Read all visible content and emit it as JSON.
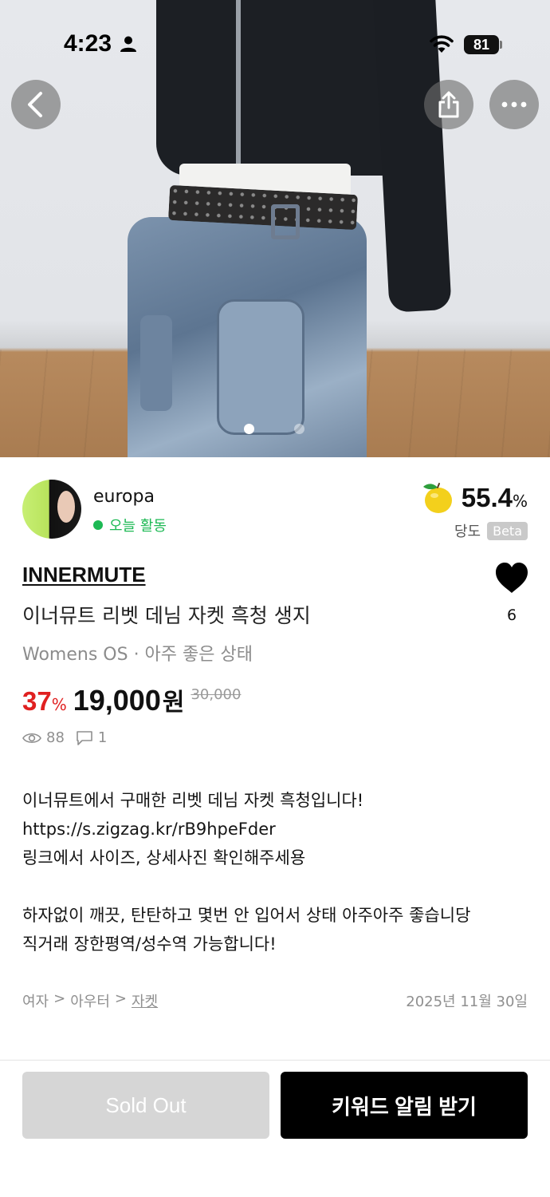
{
  "status_bar": {
    "time": "4:23",
    "battery": "81"
  },
  "gallery": {
    "image_count": 2,
    "active_index": 0
  },
  "seller": {
    "name": "europa",
    "activity": "오늘 활동"
  },
  "score": {
    "value": "55.4",
    "unit": "%",
    "label": "당도",
    "badge": "Beta"
  },
  "product": {
    "brand": "INNERMUTE",
    "title": "이너뮤트 리벳 데님 자켓 흑청 생지",
    "subtitle": "Womens OS · 아주 좋은 상태",
    "likes": "6",
    "discount": "37",
    "discount_unit": "%",
    "price": "19,000",
    "price_unit": "원",
    "original_price": "30,000",
    "views": "88",
    "comments": "1"
  },
  "description": {
    "lines": [
      "이너뮤트에서 구매한 리벳 데님 자켓 흑청입니다!",
      "https://s.zigzag.kr/rB9hpeFder",
      "링크에서 사이즈, 상세사진 확인해주세용",
      "",
      "하자없이 깨끗, 탄탄하고 몇번 안 입어서 상태 아주아주 좋습니당",
      "직거래 장한평역/성수역 가능합니다!"
    ]
  },
  "category": {
    "level1": "여자",
    "sep": ">",
    "level2": "아우터",
    "level3": "자켓"
  },
  "posted_date": "2025년 11월 30일",
  "actions": {
    "sold_out": "Sold Out",
    "keyword_alert": "키워드 알림 받기"
  },
  "colors": {
    "discount": "#e02020",
    "active_green": "#1db954",
    "primary_button": "#000000",
    "disabled_button": "#d6d6d6"
  }
}
